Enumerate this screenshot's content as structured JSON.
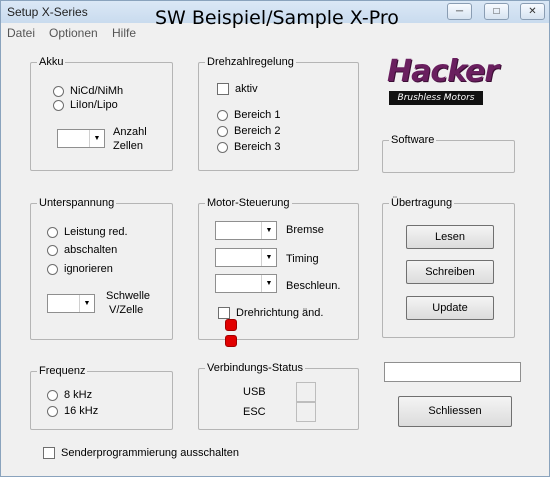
{
  "window": {
    "title": "Setup X-Series",
    "heading": "SW Beispiel/Sample X-Pro"
  },
  "menu": [
    "Datei",
    "Optionen",
    "Hilfe"
  ],
  "logo": {
    "brand": "Hacker",
    "tagline": "Brushless Motors"
  },
  "akku": {
    "legend": "Akku",
    "options": [
      "NiCd/NiMh",
      "LiIon/Lipo"
    ],
    "cells_label_1": "Anzahl",
    "cells_label_2": "Zellen",
    "cells_value": ""
  },
  "drehzahl": {
    "legend": "Drehzahlregelung",
    "active_label": "aktiv",
    "ranges": [
      "Bereich 1",
      "Bereich 2",
      "Bereich 3"
    ]
  },
  "software": {
    "legend": "Software",
    "value": ""
  },
  "unterspannung": {
    "legend": "Unterspannung",
    "options": [
      "Leistung red.",
      "abschalten",
      "ignorieren"
    ],
    "threshold_label_1": "Schwelle",
    "threshold_label_2": "V/Zelle",
    "threshold_value": ""
  },
  "motor": {
    "legend": "Motor-Steuerung",
    "brake_label": "Bremse",
    "timing_label": "Timing",
    "accel_label": "Beschleun.",
    "reverse_label": "Drehrichtung änd.",
    "status_color": "#e10000"
  },
  "transfer": {
    "legend": "Übertragung",
    "read_label": "Lesen",
    "write_label": "Schreiben",
    "update_label": "Update"
  },
  "frequency": {
    "legend": "Frequenz",
    "options": [
      "8 kHz",
      "16 kHz"
    ]
  },
  "connection": {
    "legend": "Verbindungs-Status",
    "usb_label": "USB",
    "esc_label": "ESC"
  },
  "status_field": {
    "value": ""
  },
  "close_label": "Schliessen",
  "sender_label": "Senderprogrammierung ausschalten"
}
